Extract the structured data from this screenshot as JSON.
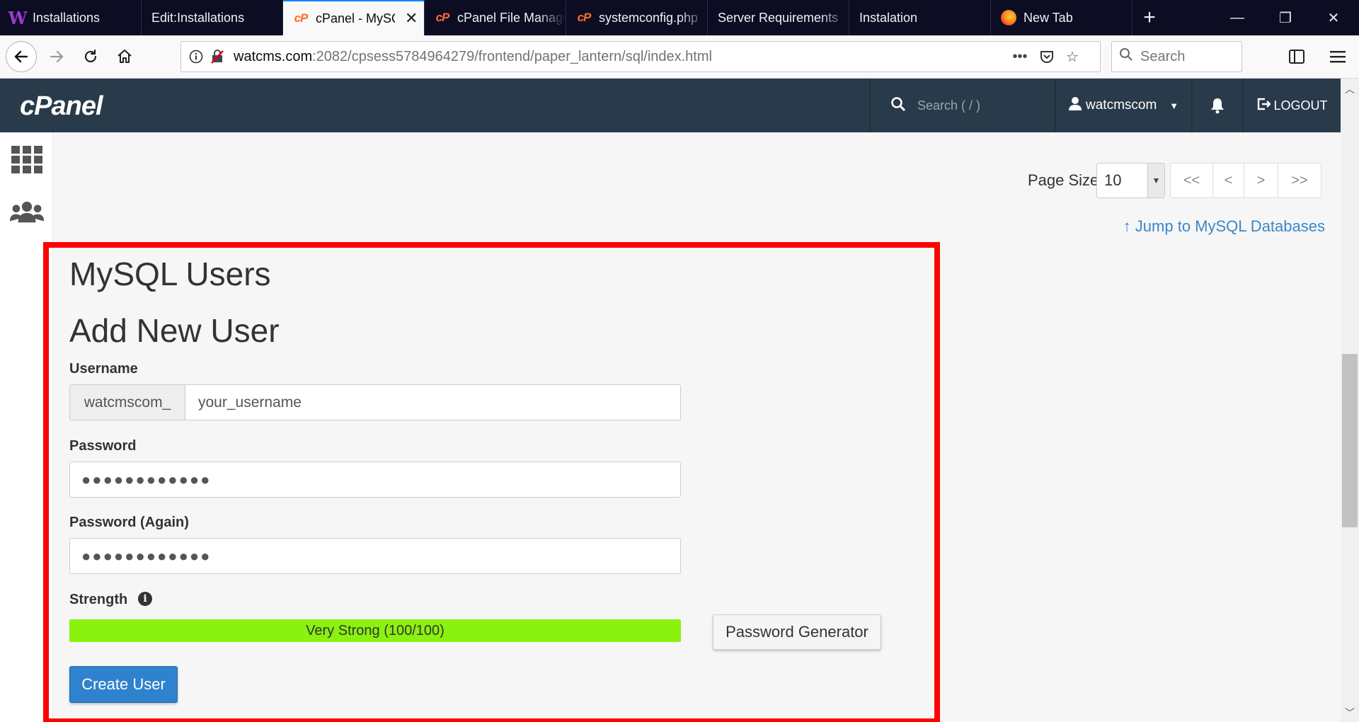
{
  "browser": {
    "tabs": [
      {
        "label": "Installations",
        "icon": "wordpress-w-icon"
      },
      {
        "label": "Edit:Installations",
        "icon": ""
      },
      {
        "label": "cPanel - MySQL",
        "icon": "cpanel-icon",
        "active": true
      },
      {
        "label": "cPanel File Manager",
        "icon": "cpanel-icon"
      },
      {
        "label": "systemconfig.php",
        "icon": "cpanel-icon"
      },
      {
        "label": "Server Requirements",
        "icon": ""
      },
      {
        "label": "Instalation",
        "icon": ""
      },
      {
        "label": "New Tab",
        "icon": "firefox-icon"
      }
    ],
    "url_host": "watcms.com",
    "url_rest": ":2082/cpsess5784964279/frontend/paper_lantern/sql/index.html",
    "search_placeholder": "Search"
  },
  "cpanel": {
    "logo": "cPanel",
    "search_placeholder": "Search ( / )",
    "username": "watcmscom",
    "logout_label": "LOGOUT"
  },
  "pagination": {
    "page_size_label": "Page Size",
    "page_size_value": "10",
    "buttons": [
      "<<",
      "<",
      ">",
      ">>"
    ]
  },
  "jump_link": "Jump to MySQL Databases",
  "section_title": "MySQL Users",
  "form": {
    "title": "Add New User",
    "username_label": "Username",
    "username_prefix": "watcmscom_",
    "username_value": "your_username",
    "password_label": "Password",
    "password_value": "●●●●●●●●●●●●",
    "password_again_label": "Password (Again)",
    "password_again_value": "●●●●●●●●●●●●",
    "strength_label": "Strength",
    "strength_text": "Very Strong (100/100)",
    "strength_percent": 100,
    "strength_color": "#8bf20f",
    "password_generator_label": "Password Generator",
    "create_button_label": "Create User"
  },
  "colors": {
    "header_bg": "#293a4a",
    "primary_button": "#2f82cd",
    "link": "#3a87c8",
    "highlight_border": "#ff0000"
  }
}
